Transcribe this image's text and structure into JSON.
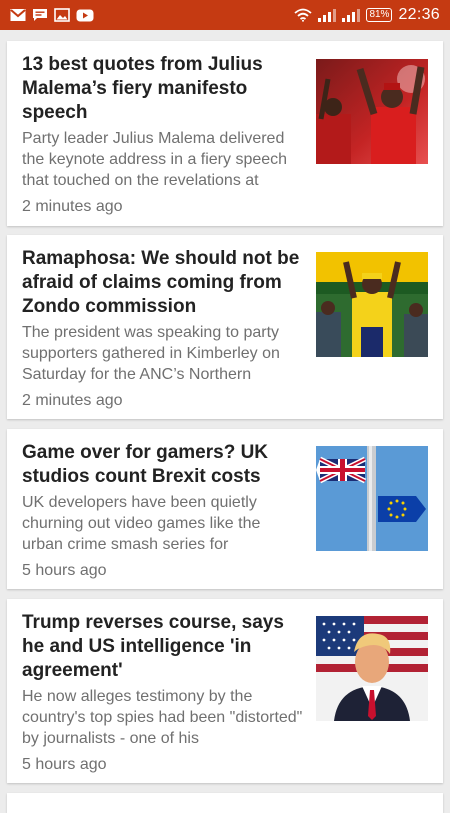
{
  "status_bar": {
    "time": "22:36",
    "battery": "81%",
    "colors": {
      "background": "#c53a12"
    },
    "icons": [
      "gmail-icon",
      "message-icon",
      "gallery-icon",
      "youtube-icon",
      "wifi-icon",
      "signal-icon",
      "signal-icon-2",
      "battery-icon"
    ]
  },
  "articles": [
    {
      "title": "13 best quotes from Julius Malema’s fiery manifesto speech",
      "excerpt": "Party leader Julius Malema delivered the keynote address in a fiery speech that touched on the revelations at",
      "time": "2 minutes ago",
      "thumbnail": "crowd-rally-photo"
    },
    {
      "title": "Ramaphosa: We should not be afraid of claims coming from Zondo commission",
      "excerpt": "The president was speaking to party supporters gathered in Kimberley on Saturday for the ANC’s Northern",
      "time": "2 minutes ago",
      "thumbnail": "president-stage-photo"
    },
    {
      "title": "Game over for gamers? UK studios count Brexit costs",
      "excerpt": "UK developers have been quietly churning out video games like the urban crime smash series for",
      "time": "5 hours ago",
      "thumbnail": "uk-eu-signpost-photo"
    },
    {
      "title": "Trump reverses course, says he and US intelligence 'in agreement'",
      "excerpt": "He now alleges testimony by the country's top spies had been \"distorted\" by journalists - one of his",
      "time": "5 hours ago",
      "thumbnail": "trump-portrait-photo"
    }
  ]
}
